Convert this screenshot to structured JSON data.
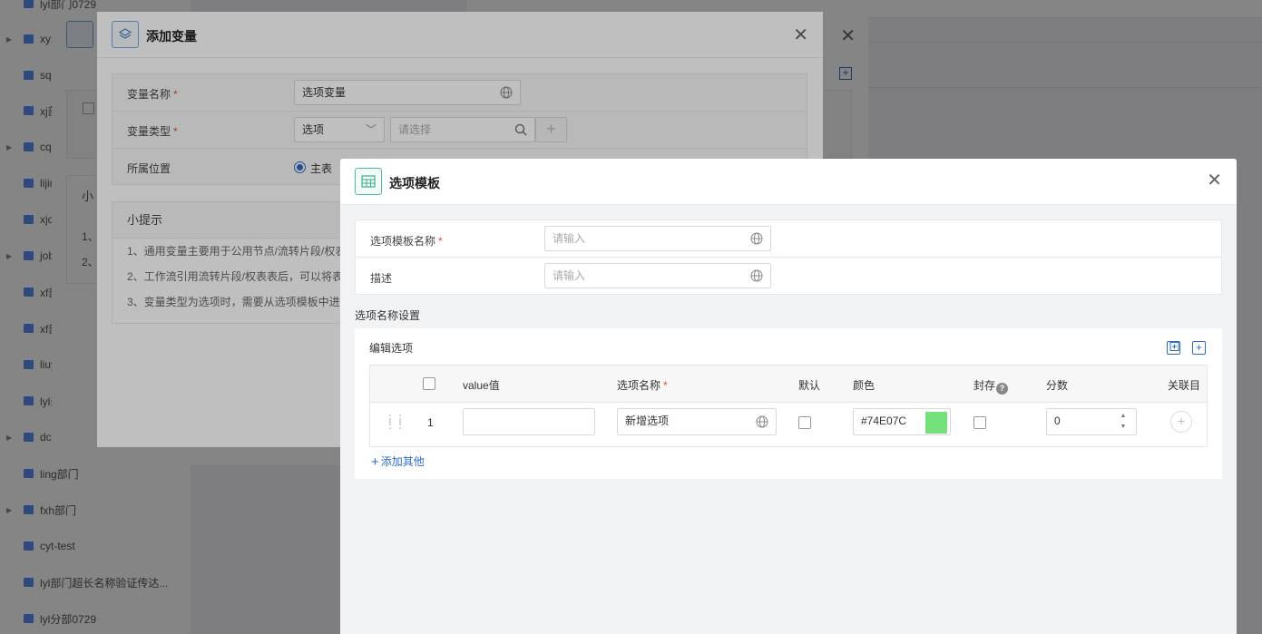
{
  "sidebar": {
    "items": [
      {
        "label": "lyl部门0729",
        "caret": false
      },
      {
        "label": "xyz",
        "caret": true
      },
      {
        "label": "sq",
        "caret": false
      },
      {
        "label": "xj部",
        "caret": false
      },
      {
        "label": "cq",
        "caret": true
      },
      {
        "label": "lijin",
        "caret": false
      },
      {
        "label": "xjc",
        "caret": false
      },
      {
        "label": "job",
        "caret": true
      },
      {
        "label": "xf部",
        "caret": false
      },
      {
        "label": "xf部",
        "caret": false
      },
      {
        "label": "liuy",
        "caret": false
      },
      {
        "label": "lyl部",
        "caret": false
      },
      {
        "label": "dc",
        "caret": true
      },
      {
        "label": "ling部门",
        "caret": false
      },
      {
        "label": "fxh部门",
        "caret": true
      },
      {
        "label": "cyt-test",
        "caret": false
      },
      {
        "label": "lyl部门超长名称验证传达...",
        "caret": false
      },
      {
        "label": "lyl分部0729",
        "caret": false
      }
    ]
  },
  "back_dialog": {
    "tip_title_partial": "小",
    "tip_line1": "1、",
    "tip_line2": "2、"
  },
  "add_variable_dialog": {
    "title": "添加变量",
    "fields": {
      "name_label": "变量名称",
      "name_value": "选项变量",
      "type_label": "变量类型",
      "type_value": "选项",
      "type_search_placeholder": "请选择",
      "location_label": "所属位置",
      "location_value": "主表"
    },
    "required_mark": "*",
    "tips": {
      "title": "小提示",
      "lines": [
        "1、通用变量主要用于公用节点/流转片段/权表",
        "2、工作流引用流转片段/权表表后，可以将表",
        "3、变量类型为选项时，需要从选项模板中进"
      ]
    }
  },
  "option_template_dialog": {
    "title": "选项模板",
    "form": {
      "name_label": "选项模板名称",
      "name_placeholder": "请输入",
      "desc_label": "描述",
      "desc_placeholder": "请输入"
    },
    "section_title": "选项名称设置",
    "panel_title": "编辑选项",
    "columns": {
      "value": "value值",
      "name": "选项名称",
      "default": "默认",
      "color": "颜色",
      "archived": "封存",
      "help": "?",
      "score": "分数",
      "related": "关联目"
    },
    "rows": [
      {
        "index": "1",
        "value": "",
        "name": "新增选项",
        "default": false,
        "color": "#74E07C",
        "archived": false,
        "score": "0"
      }
    ],
    "add_other": "添加其他"
  },
  "colors": {
    "accent": "#2d6ac6",
    "required": "#e84c3d",
    "swatch": "#74E07C"
  }
}
